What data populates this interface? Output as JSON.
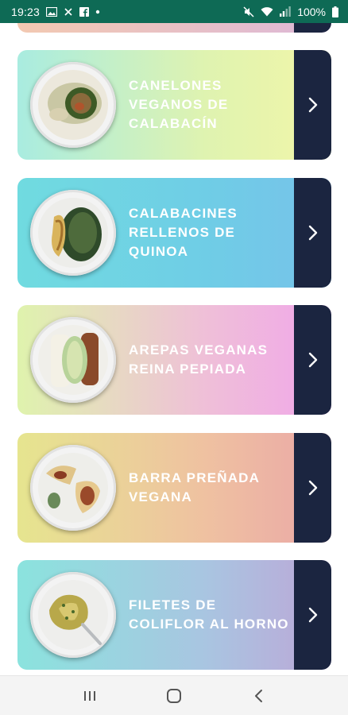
{
  "status_bar": {
    "time": "19:23",
    "battery_text": "100%",
    "left_icons": [
      "gallery-icon",
      "missed-call-icon",
      "facebook-icon",
      "dot-icon"
    ],
    "right_icons": [
      "mute-icon",
      "wifi-icon",
      "signal-icon",
      "battery-icon"
    ]
  },
  "recipes": [
    {
      "title": "",
      "partial": true
    },
    {
      "title": "CANELONES VEGANOS DE CALABACÍN"
    },
    {
      "title": "CALABACINES RELLENOS DE QUINOA"
    },
    {
      "title": "AREPAS VEGANAS REINA PEPIADA"
    },
    {
      "title": "BARRA PREÑADA VEGANA"
    },
    {
      "title": "FILETES DE COLIFLOR AL HORNO"
    }
  ],
  "colors": {
    "status_bar": "#0e6a55",
    "arrow_panel": "#1b2540",
    "nav_bar": "#f4f4f4"
  },
  "nav": [
    "recents-icon",
    "home-icon",
    "back-icon"
  ]
}
